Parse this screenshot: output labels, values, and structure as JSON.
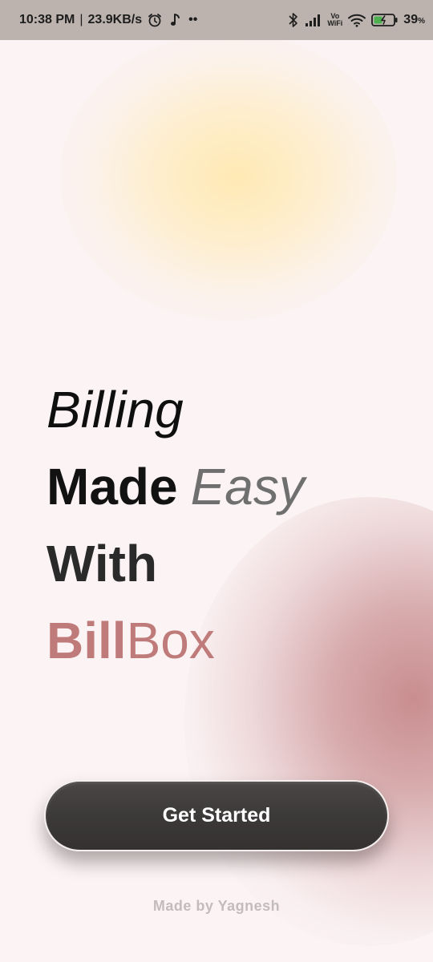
{
  "status_bar": {
    "time": "10:38 PM",
    "separator": "|",
    "network_speed": "23.9KB/s",
    "more_dots": "••",
    "volte_top": "Vo",
    "volte_bottom": "WiFi",
    "battery_percent": "39",
    "battery_unit": "%",
    "icons": [
      "alarm-icon",
      "music-note-icon",
      "bluetooth-icon",
      "signal-icon",
      "vowifi-icon",
      "wifi-icon",
      "battery-charging-icon"
    ]
  },
  "headline": {
    "line1": "Billing",
    "line2_bold": "Made",
    "line2_italic": "Easy",
    "line3": "With",
    "brand_bold": "Bill",
    "brand_light": "Box"
  },
  "cta": {
    "label": "Get Started"
  },
  "footer": {
    "credit": "Made by Yagnesh"
  },
  "colors": {
    "background": "#fbf3f4",
    "brand": "#bf7b79",
    "button": "#3b3838",
    "status_bar": "#bcb3ae"
  }
}
